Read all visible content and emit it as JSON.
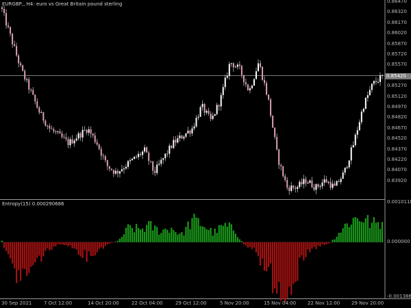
{
  "main_chart": {
    "title": "EURGBP,, H4:  euro vs Great Britain pound sterling",
    "price_labels": [
      "0.86470",
      "0.86320",
      "0.86170",
      "0.86020",
      "0.85870",
      "0.85720",
      "0.85570",
      "0.85420",
      "0.85270",
      "0.85120",
      "0.84970",
      "0.84820",
      "0.84670",
      "0.84520",
      "0.84370",
      "0.84220",
      "0.84070",
      "0.83920"
    ],
    "current_price": "0.85420",
    "colors": {
      "bull": "#ffffff",
      "bear": "#e0a0b0",
      "wick": "#bbbbbb",
      "background": "#000000"
    }
  },
  "indicator": {
    "title": "Entropy(15) 0.000290686",
    "top_label": "0.00101187",
    "zero_label": "0.000000",
    "bottom_label": "-0.00138615",
    "colors": {
      "positive": "#1a9a1a",
      "negative": "#a41212"
    }
  },
  "time_axis": {
    "labels": [
      "30 Sep 2021",
      "7 Oct 12:00",
      "14 Oct 20:00",
      "22 Oct 04:00",
      "29 Oct 12:00",
      "5 Nov 20:00",
      "15 Nov 04:00",
      "22 Nov 12:00",
      "29 Nov 20:00"
    ]
  },
  "chart_data": [
    {
      "type": "candlestick",
      "title": "EURGBP,, H4:  euro vs Great Britain pound sterling",
      "ylim": [
        0.8387,
        0.8652
      ],
      "anchors_close": [
        0.864,
        0.86,
        0.856,
        0.853,
        0.85,
        0.848,
        0.847,
        0.846,
        0.847,
        0.848,
        0.846,
        0.843,
        0.842,
        0.843,
        0.844,
        0.845,
        0.842,
        0.844,
        0.846,
        0.847,
        0.848,
        0.851,
        0.849,
        0.852,
        0.857,
        0.856,
        0.853,
        0.857,
        0.852,
        0.844,
        0.84,
        0.84,
        0.841,
        0.84,
        0.841,
        0.84,
        0.842,
        0.846,
        0.851,
        0.854,
        0.855
      ]
    },
    {
      "type": "bar",
      "title": "Entropy(15) 0.000290686",
      "ylim": [
        -0.00138615,
        0.00101187
      ],
      "anchors_value": [
        3e-05,
        -0.0008,
        -0.00095,
        -0.00065,
        -0.0003,
        -0.0001,
        -5e-05,
        -0.0002,
        -0.0004,
        -0.00025,
        -5e-05,
        3e-05,
        0.0004,
        0.00035,
        0.00045,
        0.0003,
        0.0004,
        0.0002,
        0.0006,
        0.0005,
        0.00025,
        0.00045,
        0.00035,
        -0.0001,
        -0.0002,
        -0.0008,
        -0.00115,
        -0.0013,
        -0.0008,
        -0.0003,
        -0.0001,
        -5e-05,
        0.0003,
        0.0006,
        0.0007,
        0.0005,
        0.00055
      ]
    }
  ]
}
